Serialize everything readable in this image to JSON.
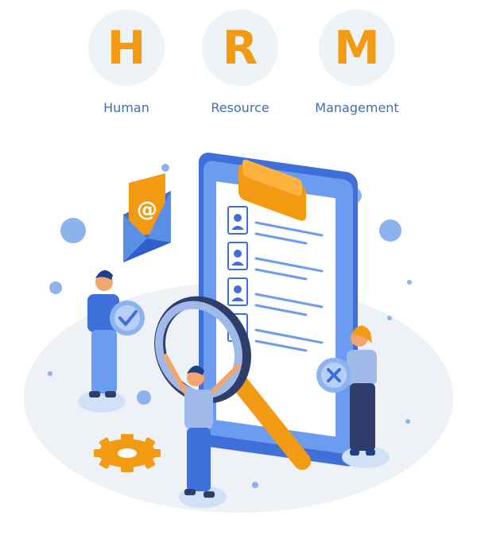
{
  "header": {
    "letters": [
      "H",
      "R",
      "M"
    ],
    "words": [
      "Human",
      "Resource",
      "Management"
    ]
  },
  "colors": {
    "accent_orange": "#f39a13",
    "brand_blue": "#3f6fb8",
    "clipboard_blue": "#5b8fe6",
    "light_bg": "#eef3f8"
  },
  "illustration": {
    "icons": [
      "email-at-icon",
      "user-profile-icon",
      "checkmark-icon",
      "x-mark-icon",
      "gear-icon",
      "magnifier-icon"
    ]
  }
}
